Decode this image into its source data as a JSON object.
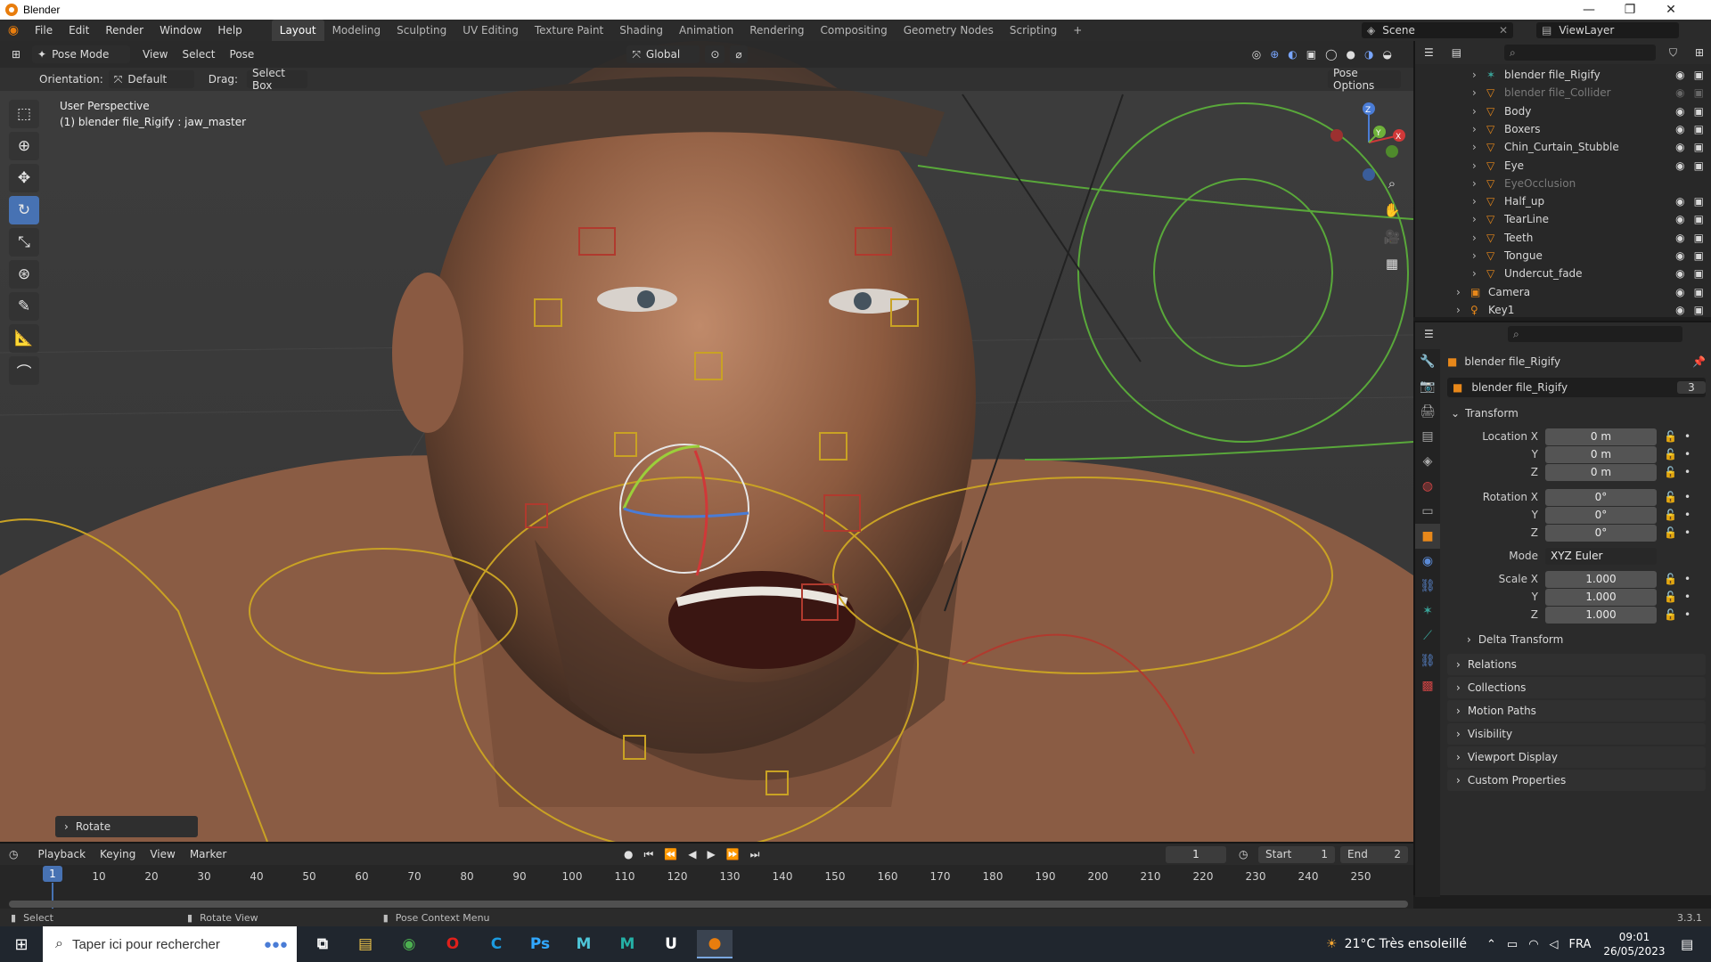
{
  "window": {
    "title": "Blender",
    "min": "—",
    "max": "❐",
    "close": "✕"
  },
  "menus": [
    "File",
    "Edit",
    "Render",
    "Window",
    "Help"
  ],
  "workspaces": [
    "Layout",
    "Modeling",
    "Sculpting",
    "UV Editing",
    "Texture Paint",
    "Shading",
    "Animation",
    "Rendering",
    "Compositing",
    "Geometry Nodes",
    "Scripting",
    "+"
  ],
  "active_workspace": "Layout",
  "scene": {
    "name": "Scene",
    "view_layer": "ViewLayer"
  },
  "viewport": {
    "mode": "Pose Mode",
    "menus": [
      "View",
      "Select",
      "Pose"
    ],
    "transform_space": "Global",
    "orientation_label": "Orientation:",
    "orientation": "Default",
    "drag_label": "Drag:",
    "drag": "Select Box",
    "pose_options": "Pose Options",
    "perspective": "User Perspective",
    "active_info": "(1) blender file_Rigify : jaw_master",
    "last_op": "Rotate",
    "gizmo_axes": {
      "x": "X",
      "y": "Y",
      "z": "Z"
    }
  },
  "outliner": {
    "items": [
      {
        "name": "blender file_Rigify",
        "dim": false
      },
      {
        "name": "blender file_Collider",
        "dim": true
      },
      {
        "name": "Body",
        "dim": false
      },
      {
        "name": "Boxers",
        "dim": false
      },
      {
        "name": "Chin_Curtain_Stubble",
        "dim": false
      },
      {
        "name": "Eye",
        "dim": false
      },
      {
        "name": "EyeOcclusion",
        "dim": true
      },
      {
        "name": "Half_up",
        "dim": false
      },
      {
        "name": "TearLine",
        "dim": false
      },
      {
        "name": "Teeth",
        "dim": false
      },
      {
        "name": "Tongue",
        "dim": false
      },
      {
        "name": "Undercut_fade",
        "dim": false
      },
      {
        "name": "Camera",
        "dim": false
      },
      {
        "name": "Key1",
        "dim": false
      }
    ]
  },
  "properties": {
    "object_name": "blender file_Rigify",
    "data_name": "blender file_Rigify",
    "users": "3",
    "transform_title": "Transform",
    "location": {
      "label": "Location X",
      "x": "0 m",
      "y": "0 m",
      "z": "0 m"
    },
    "rotation": {
      "label": "Rotation X",
      "x": "0°",
      "y": "0°",
      "z": "0°"
    },
    "mode_label": "Mode",
    "mode": "XYZ Euler",
    "scale": {
      "label": "Scale X",
      "x": "1.000",
      "y": "1.000",
      "z": "1.000"
    },
    "axis_y": "Y",
    "axis_z": "Z",
    "delta": "Delta Transform",
    "sections": [
      "Relations",
      "Collections",
      "Motion Paths",
      "Visibility",
      "Viewport Display",
      "Custom Properties"
    ]
  },
  "timeline": {
    "menus": [
      "Playback",
      "Keying",
      "View",
      "Marker"
    ],
    "current_frame": "1",
    "start_label": "Start",
    "start": "1",
    "end_label": "End",
    "end": "2",
    "ticks": [
      "10",
      "20",
      "30",
      "40",
      "50",
      "60",
      "70",
      "80",
      "90",
      "100",
      "110",
      "120",
      "130",
      "140",
      "150",
      "160",
      "170",
      "180",
      "190",
      "200",
      "210",
      "220",
      "230",
      "240",
      "250"
    ]
  },
  "status": {
    "select": "Select",
    "rotate": "Rotate View",
    "context": "Pose Context Menu",
    "version": "3.3.1"
  },
  "taskbar": {
    "search_placeholder": "Taper ici pour rechercher",
    "weather": "21°C  Très ensoleillé",
    "lang": "FRA",
    "time": "09:01",
    "date": "26/05/2023",
    "apps": [
      {
        "name": "file-explorer-icon",
        "glyph": "▤",
        "color": "#f3c84b"
      },
      {
        "name": "chrome-icon",
        "glyph": "◉",
        "color": "#4caf50"
      },
      {
        "name": "opera-icon",
        "glyph": "O",
        "color": "#e0201b"
      },
      {
        "name": "cortana-icon",
        "glyph": "C",
        "color": "#1c9be0"
      },
      {
        "name": "photoshop-icon",
        "glyph": "Ps",
        "color": "#31a8ff"
      },
      {
        "name": "maya-icon",
        "glyph": "M",
        "color": "#4ec5d8"
      },
      {
        "name": "mudbox-icon",
        "glyph": "M",
        "color": "#25b0a6"
      },
      {
        "name": "unreal-icon",
        "glyph": "U",
        "color": "#ffffff"
      },
      {
        "name": "blender-icon",
        "glyph": "●",
        "color": "#e87d0d"
      }
    ]
  }
}
